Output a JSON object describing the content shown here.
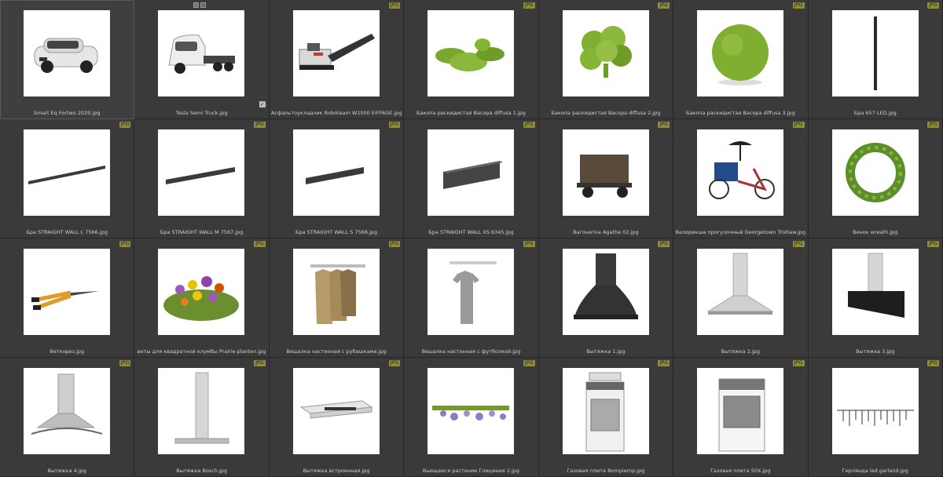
{
  "browser": {
    "badge_color": "#8d8c3e",
    "background": "#2b2b2b",
    "items": [
      {
        "label": "Smart Eq Fortwo 2020.jpg",
        "badge": "",
        "icon": "car-thumbnail"
      },
      {
        "label": "Tesla Semi Truck.jpg",
        "badge": "",
        "icon": "truck-thumbnail"
      },
      {
        "label": "Асфальтоукладчик Roboteam W1500 EIFFAGE.jpg",
        "badge": "JPG",
        "icon": "asphalt-machine-thumbnail"
      },
      {
        "label": "Бакопа раскидистая Bacopa diffusa 1.jpg",
        "badge": "JPG",
        "icon": "plant-thumbnail"
      },
      {
        "label": "Бакопа раскидистая Bacopa diffusa 2.jpg",
        "badge": "JPG",
        "icon": "plant-thumbnail"
      },
      {
        "label": "Бакопа раскидистая Bacopa diffusa 3.jpg",
        "badge": "JPG",
        "icon": "ball-shrub-thumbnail"
      },
      {
        "label": "Бра 657 LED.jpg",
        "badge": "JPG",
        "icon": "wall-lamp-thumbnail"
      },
      {
        "label": "Бра STRAIGHT WALL L 7566.jpg",
        "badge": "JPG",
        "icon": "linear-lamp-thumbnail"
      },
      {
        "label": "Бра STRAIGHT WALL M 7567.jpg",
        "badge": "JPG",
        "icon": "linear-lamp-thumbnail"
      },
      {
        "label": "Бра STRAIGHT WALL S 7568.jpg",
        "badge": "JPG",
        "icon": "linear-lamp-thumbnail"
      },
      {
        "label": "Бра STRAIGHT WALL XS 6345.jpg",
        "badge": "JPG",
        "icon": "box-lamp-thumbnail"
      },
      {
        "label": "Вагонетка Agathe 02.jpg",
        "badge": "JPG",
        "icon": "wagon-thumbnail"
      },
      {
        "label": "Велорикша прогулочный Georgetown Trishaw.jpg",
        "badge": "JPG",
        "icon": "trishaw-thumbnail"
      },
      {
        "label": "Венок wreath.jpg",
        "badge": "JPG",
        "icon": "wreath-thumbnail"
      },
      {
        "label": "Веткорез.jpg",
        "badge": "JPG",
        "icon": "lopper-thumbnail"
      },
      {
        "label": "веты для квадратной клумбы Prairie planten.jpg",
        "badge": "JPG",
        "icon": "flowerbed-thumbnail"
      },
      {
        "label": "Вешалка настенная с рубашками.jpg",
        "badge": "JPG",
        "icon": "shirts-rack-thumbnail"
      },
      {
        "label": "Вешалка настенная с футболкой.jpg",
        "badge": "JPG",
        "icon": "tshirt-rack-thumbnail"
      },
      {
        "label": "Вытяжка 1.jpg",
        "badge": "JPG",
        "icon": "hood-thumbnail"
      },
      {
        "label": "Вытяжка 2.jpg",
        "badge": "JPG",
        "icon": "hood-thumbnail"
      },
      {
        "label": "Вытяжка 3.jpg",
        "badge": "JPG",
        "icon": "hood-thumbnail"
      },
      {
        "label": "Вытяжка 4.jpg",
        "badge": "JPG",
        "icon": "hood-thumbnail"
      },
      {
        "label": "Вытяжка Bosch.jpg",
        "badge": "JPG",
        "icon": "hood-thumbnail"
      },
      {
        "label": "Вытяжка встроенная.jpg",
        "badge": "JPG",
        "icon": "hood-thumbnail"
      },
      {
        "label": "Вьющееся растение Глициния 2.jpg",
        "badge": "JPG",
        "icon": "plant-thumbnail"
      },
      {
        "label": "Газовая плита Bompiemp.jpg",
        "badge": "JPG",
        "icon": "stove-thumbnail"
      },
      {
        "label": "Газовая плита 50X.jpg",
        "badge": "JPG",
        "icon": "stove-thumbnail"
      },
      {
        "label": "Гирлянда led garland.jpg",
        "badge": "JPG",
        "icon": "garland-thumbnail"
      }
    ]
  }
}
